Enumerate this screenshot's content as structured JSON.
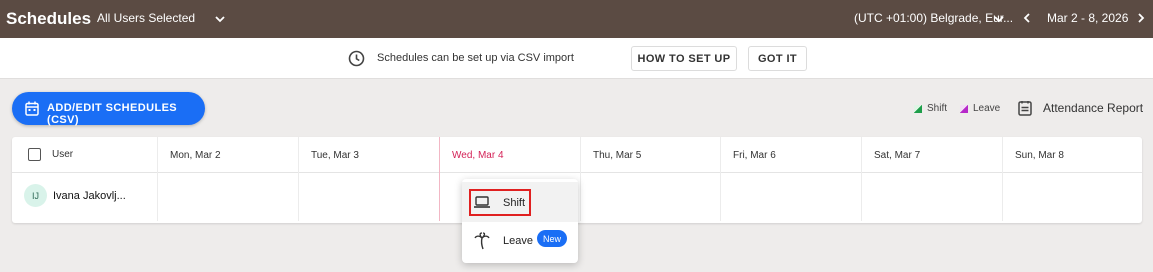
{
  "header": {
    "title": "Schedules",
    "user_filter": "All Users Selected",
    "timezone": "(UTC +01:00) Belgrade, Eur...",
    "date_range": "Mar 2 - 8, 2026"
  },
  "banner": {
    "text": "Schedules can be set up via CSV import",
    "how_to_label": "HOW TO SET UP",
    "got_it_label": "GOT IT"
  },
  "toolbar": {
    "add_schedules_label": "ADD/EDIT SCHEDULES (CSV)",
    "legend": [
      {
        "label": "Shift",
        "color": "#1e9e4a"
      },
      {
        "label": "Leave",
        "color": "#b629c9"
      }
    ],
    "attendance_report_label": "Attendance Report"
  },
  "grid": {
    "user_column_label": "User",
    "days": [
      {
        "label": "Mon, Mar 2",
        "today": false
      },
      {
        "label": "Tue, Mar 3",
        "today": false
      },
      {
        "label": "Wed, Mar 4",
        "today": true
      },
      {
        "label": "Thu, Mar 5",
        "today": false
      },
      {
        "label": "Fri, Mar 6",
        "today": false
      },
      {
        "label": "Sat, Mar 7",
        "today": false
      },
      {
        "label": "Sun, Mar 8",
        "today": false
      }
    ],
    "rows": [
      {
        "initials": "IJ",
        "name": "Ivana Jakovlj..."
      }
    ]
  },
  "menu": {
    "items": [
      {
        "label": "Shift",
        "icon": "laptop-icon"
      },
      {
        "label": "Leave",
        "icon": "palm-tree-icon",
        "badge": "New"
      }
    ]
  },
  "colors": {
    "topbar": "#5b4b43",
    "accent": "#1a6ef5",
    "today": "#d42257",
    "highlight": "#e02020"
  }
}
